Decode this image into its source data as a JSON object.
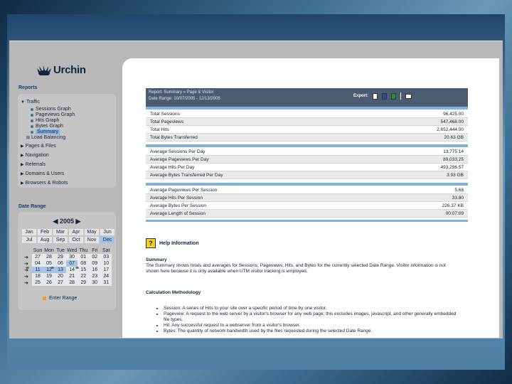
{
  "brand": {
    "name": "Urchin"
  },
  "sidebar": {
    "reports_label": "Reports",
    "traffic": {
      "label": "Traffic",
      "items": [
        "Sessions Graph",
        "Pageviews Graph",
        "Hits Graph",
        "Bytes Graph",
        "Summary"
      ],
      "selected_index": 4,
      "extra": "Load Balancing"
    },
    "groups": [
      "Pages & Files",
      "Navigation",
      "Referrals",
      "Domains & Users",
      "Browsers & Robots"
    ],
    "date_range_label": "Date Range"
  },
  "calendar": {
    "year": "2005",
    "months": [
      "Jan",
      "Feb",
      "Mar",
      "Apr",
      "May",
      "Jun",
      "Jul",
      "Aug",
      "Sep",
      "Oct",
      "Nov",
      "Dec"
    ],
    "selected_month": "Dec",
    "weekday_headers": [
      "Sun",
      "Mon",
      "Tue",
      "Wed",
      "Thu",
      "Fri",
      "Sat"
    ],
    "weeks": [
      [
        "27",
        "28",
        "29",
        "30",
        "01",
        "02",
        "03"
      ],
      [
        "04",
        "05",
        "06",
        "07",
        "08",
        "09",
        "10"
      ],
      [
        "11",
        "12",
        "13",
        "14",
        "15",
        "16",
        "17"
      ],
      [
        "18",
        "19",
        "20",
        "21",
        "22",
        "23",
        "24"
      ],
      [
        "25",
        "26",
        "27",
        "28",
        "29",
        "30",
        "31"
      ]
    ],
    "enter_label": "Enter Range"
  },
  "report": {
    "line1": "Report: Summary » Page & Visitor",
    "line2": "Date Range: 10/07/2005 - 12/13/2005",
    "export_label": "Export:"
  },
  "totals": [
    {
      "label": "Total Sessions",
      "value": "96,425.00"
    },
    {
      "label": "Total Pageviews",
      "value": "547,468.00"
    },
    {
      "label": "Total Hits",
      "value": "2,652,444.00"
    },
    {
      "label": "Total Bytes Transferred",
      "value": "20.63 GB"
    }
  ],
  "averages_day": [
    {
      "label": "Average Sessions Per Day",
      "value": "13,775.14"
    },
    {
      "label": "Average Pageviews Per Day",
      "value": "89,033.25"
    },
    {
      "label": "Average Hits Per Day",
      "value": "493,296.57"
    },
    {
      "label": "Average Bytes Transferred Per Day",
      "value": "3.93 GB"
    }
  ],
  "averages_session": [
    {
      "label": "Average Pageviews Per Session",
      "value": "5.68"
    },
    {
      "label": "Average Hits Per Session",
      "value": "33.80"
    },
    {
      "label": "Average Bytes Per Session",
      "value": "226.37 KB"
    },
    {
      "label": "Average Length of Session",
      "value": "00:07:09"
    }
  ],
  "help": {
    "title": "Help Information",
    "summary_heading": "Summary",
    "summary_text": "The Summary shows totals and averages for Sessions, Pageviews, Hits, and Bytes for the currently selected Date Range. Visitor information is not shown here because it is only available when UTM visitor tracking is employed.",
    "method_heading": "Calculation Methodology",
    "bullets": [
      "Session: A series of Hits to your site over a specific period of time by one visitor.",
      "Pageview: A request to the web server by a visitor's browser for any web page; this excludes images, javascript, and other generally embedded file types.",
      "Hit: Any successful request to a webserver from a visitor's browser.",
      "Bytes: The quantity of network bandwidth used by the files requested during the selected Date Range."
    ]
  }
}
